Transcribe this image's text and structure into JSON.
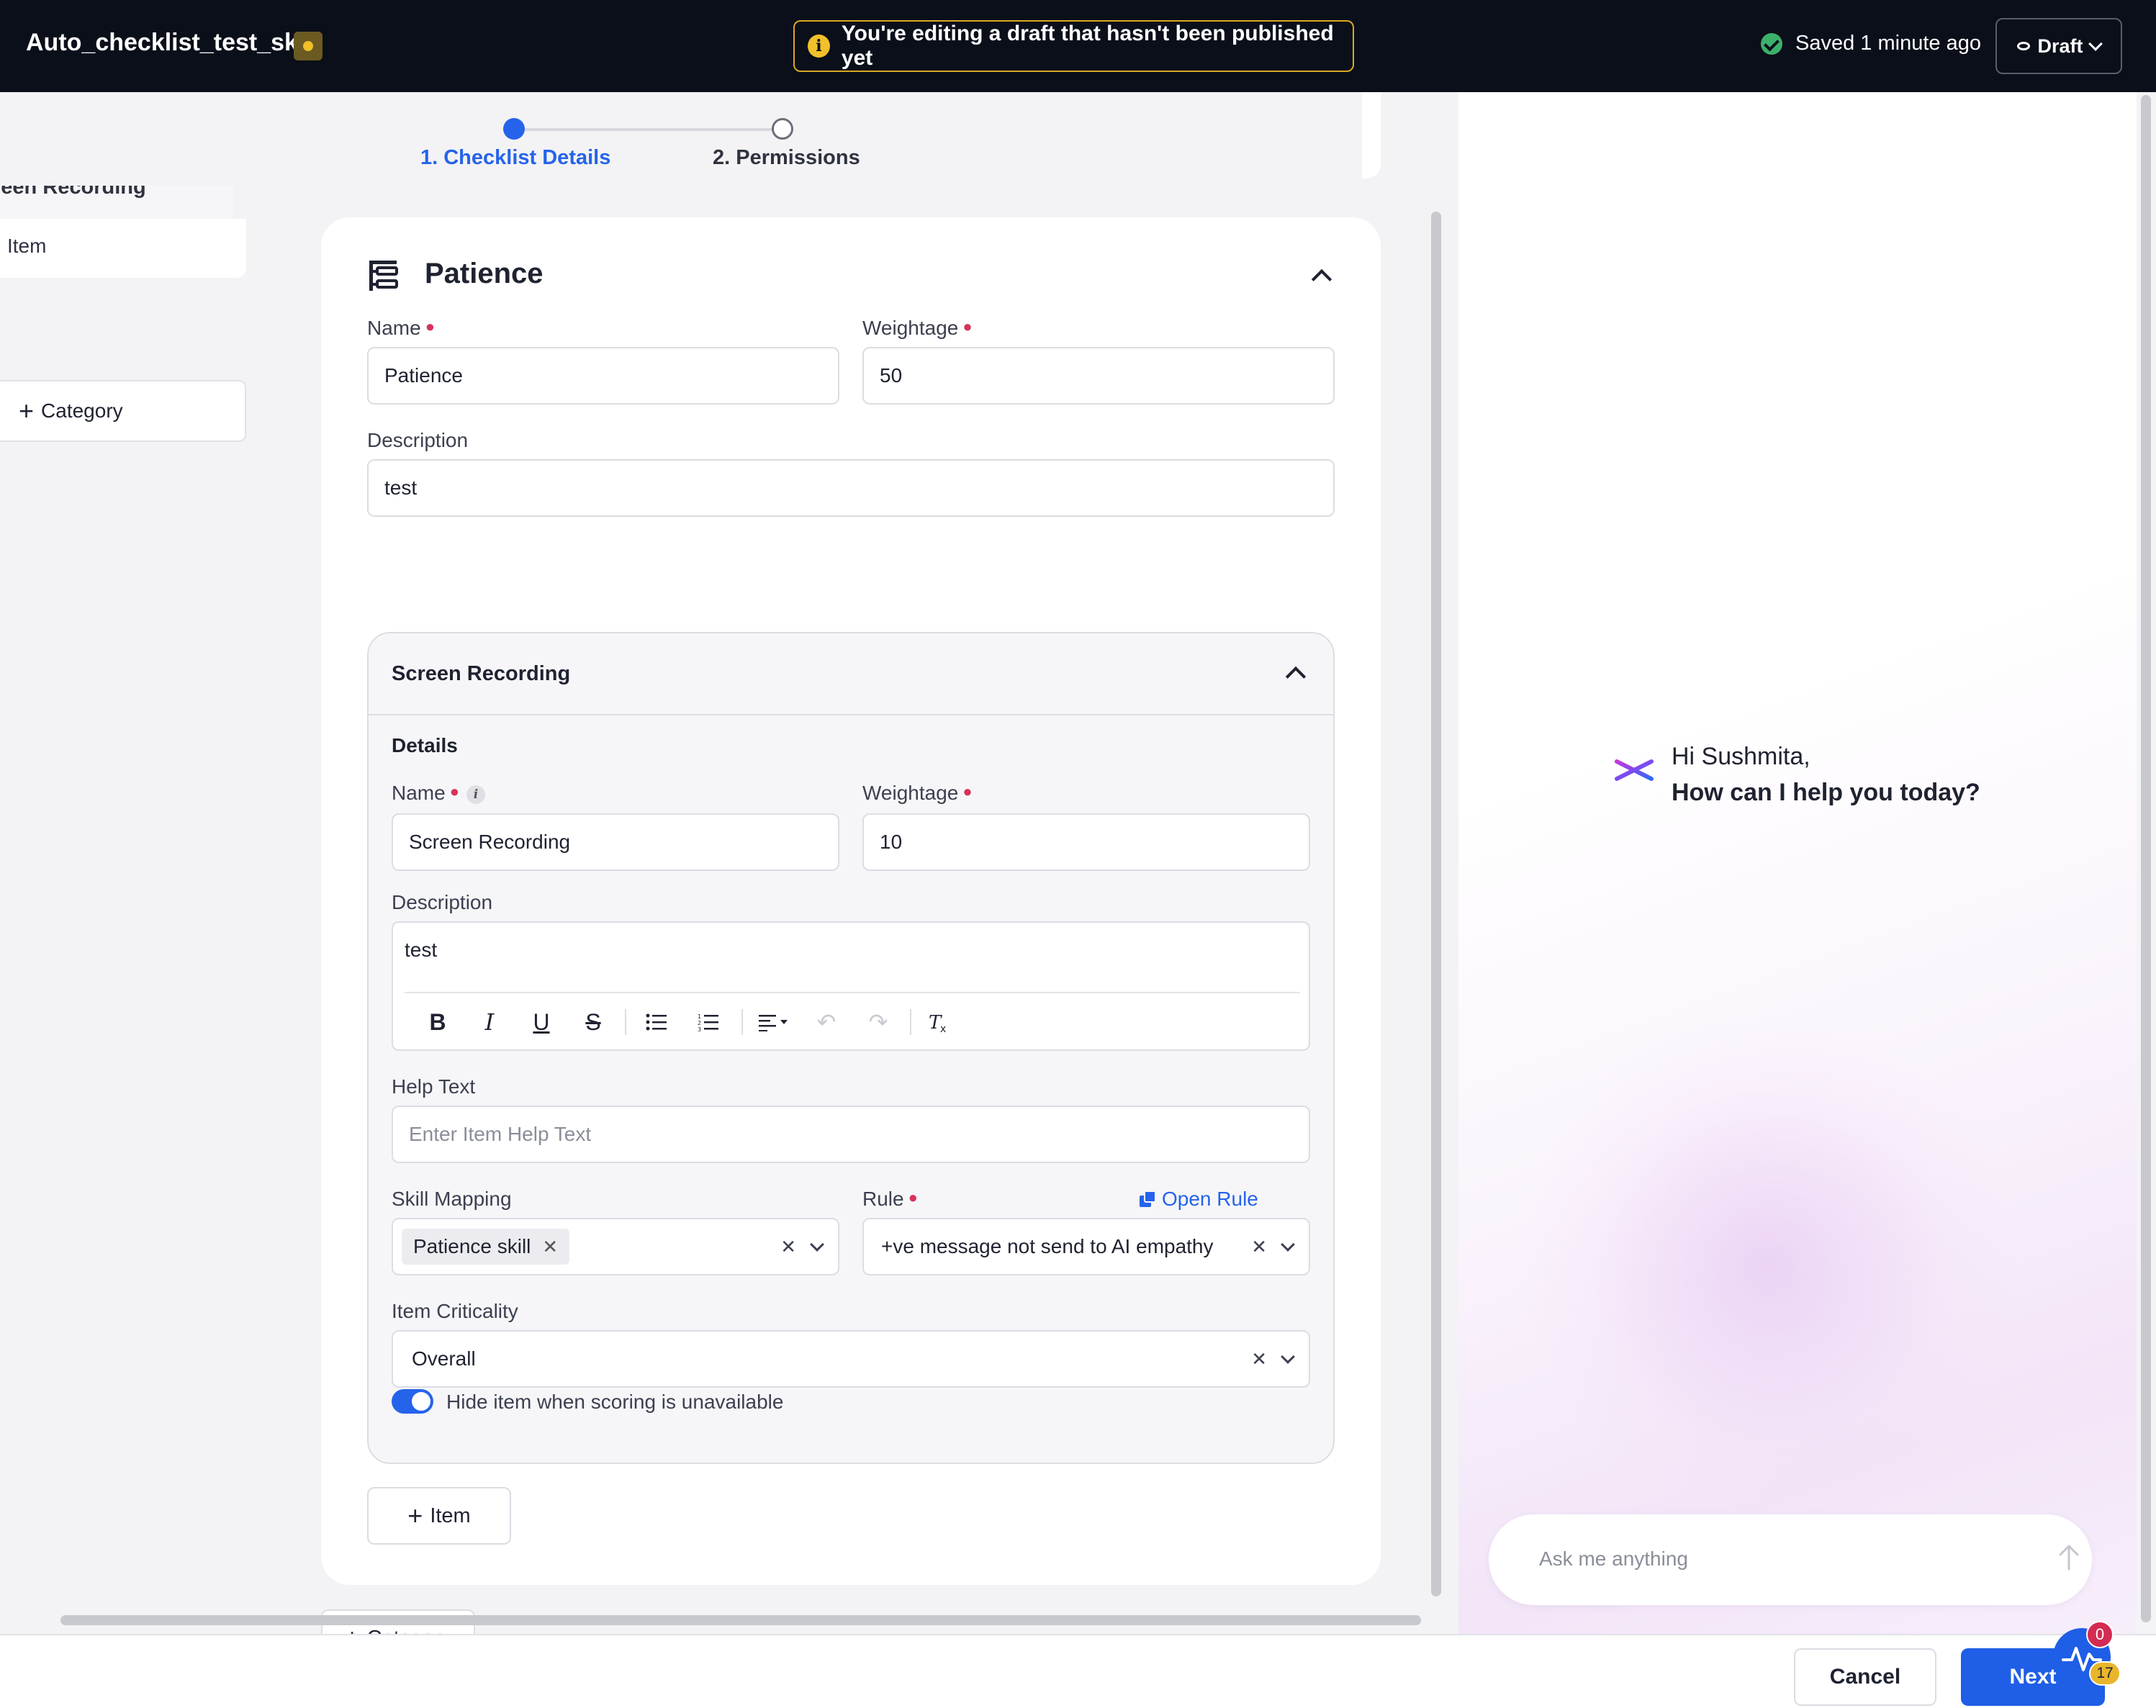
{
  "header": {
    "app_title": "Auto_checklist_test_sk",
    "draft_banner": "You're editing a draft that hasn't been published yet",
    "banner_icon_glyph": "i",
    "saved_status": "Saved 1 minute ago",
    "draft_dropdown_label": "Draft"
  },
  "stepper": {
    "steps": [
      {
        "label": "1. Checklist Details",
        "active": true
      },
      {
        "label": "2. Permissions",
        "active": false
      }
    ]
  },
  "sidebar": {
    "partial_item": "reen Recording",
    "item": "Item",
    "add_category": "Category"
  },
  "category": {
    "title": "Patience",
    "name_label": "Name",
    "name_value": "Patience",
    "weightage_label": "Weightage",
    "weightage_value": "50",
    "description_label": "Description",
    "description_value": "test",
    "item": {
      "title": "Screen Recording",
      "details_label": "Details",
      "name_label": "Name",
      "name_value": "Screen Recording",
      "weightage_label": "Weightage",
      "weightage_value": "10",
      "description_label": "Description",
      "description_value": "test",
      "help_text_label": "Help Text",
      "help_text_placeholder": "Enter Item Help Text",
      "skill_mapping_label": "Skill Mapping",
      "skill_chip": "Patience skill",
      "rule_label": "Rule",
      "open_rule_link": "Open Rule",
      "rule_value": "+ve message not send to AI empathy",
      "criticality_label": "Item Criticality",
      "criticality_value": "Overall",
      "hide_toggle_label": "Hide item when scoring is unavailable",
      "hide_toggle_on": true
    },
    "add_item": "Item"
  },
  "add_category_bottom": "Category",
  "ai_panel": {
    "greeting_line1": "Hi Sushmita,",
    "greeting_line2": "How can I help you today?",
    "input_placeholder": "Ask me anything"
  },
  "footer": {
    "cancel": "Cancel",
    "next": "Next",
    "fab_badge_count": "0",
    "fab_secondary_count": "17"
  },
  "colors": {
    "topbar_bg": "#0b0f1a",
    "accent_blue": "#2563eb",
    "warning_yellow": "#f1c02a",
    "required_red": "#d6325c",
    "success_green": "#3cb06a"
  }
}
